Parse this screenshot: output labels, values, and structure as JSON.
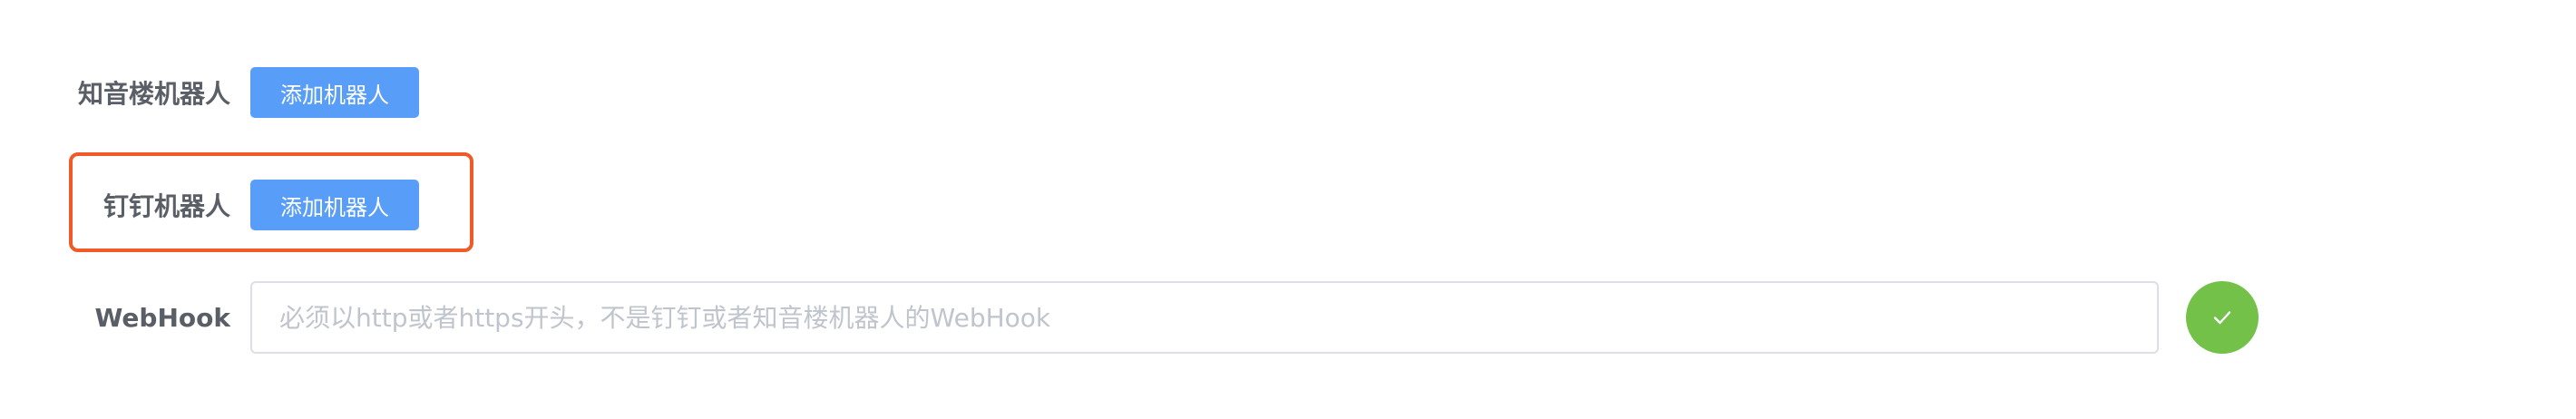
{
  "zhiyin": {
    "label": "知音楼机器人",
    "button_label": "添加机器人"
  },
  "dingding": {
    "label": "钉钉机器人",
    "button_label": "添加机器人"
  },
  "webhook": {
    "label": "WebHook",
    "value": "",
    "placeholder": "必须以http或者https开头，不是钉钉或者知音楼机器人的WebHook"
  },
  "icons": {
    "confirm": "check-icon"
  },
  "colors": {
    "primary_button": "#589ef8",
    "confirm_button": "#74c14a",
    "highlight_border": "#ef5a28"
  }
}
